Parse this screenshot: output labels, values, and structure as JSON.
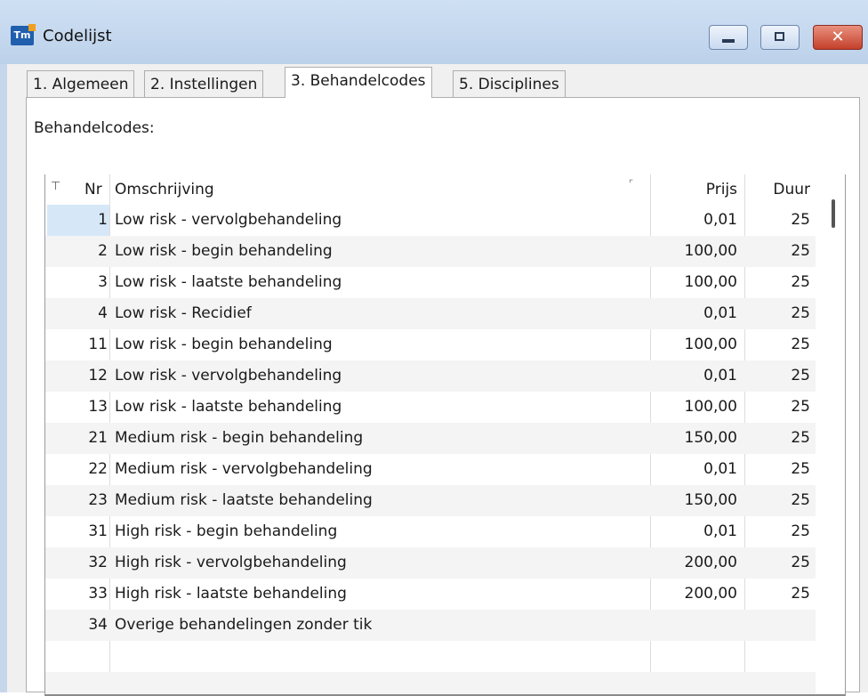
{
  "window": {
    "title": "Codelijst"
  },
  "tabs": [
    {
      "label": "1. Algemeen"
    },
    {
      "label": "2. Instellingen"
    },
    {
      "label": "3. Behandelcodes"
    },
    {
      "label": "5. Disciplines"
    }
  ],
  "active_tab": "3. Behandelcodes",
  "section": {
    "label": "Behandelcodes:"
  },
  "grid": {
    "columns": {
      "nr": "Nr",
      "omschrijving": "Omschrijving",
      "prijs": "Prijs",
      "duur": "Duur"
    },
    "rows": [
      {
        "nr": "1",
        "omschrijving": "Low risk - vervolgbehandeling",
        "prijs": "0,01",
        "duur": "25"
      },
      {
        "nr": "2",
        "omschrijving": "Low risk - begin behandeling",
        "prijs": "100,00",
        "duur": "25"
      },
      {
        "nr": "3",
        "omschrijving": "Low risk - laatste behandeling",
        "prijs": "100,00",
        "duur": "25"
      },
      {
        "nr": "4",
        "omschrijving": "Low risk - Recidief",
        "prijs": "0,01",
        "duur": "25"
      },
      {
        "nr": "11",
        "omschrijving": "Low risk - begin behandeling",
        "prijs": "100,00",
        "duur": "25"
      },
      {
        "nr": "12",
        "omschrijving": "Low risk - vervolgbehandeling",
        "prijs": "0,01",
        "duur": "25"
      },
      {
        "nr": "13",
        "omschrijving": "Low risk - laatste behandeling",
        "prijs": "100,00",
        "duur": "25"
      },
      {
        "nr": "21",
        "omschrijving": "Medium risk - begin behandeling",
        "prijs": "150,00",
        "duur": "25"
      },
      {
        "nr": "22",
        "omschrijving": "Medium risk - vervolgbehandeling",
        "prijs": "0,01",
        "duur": "25"
      },
      {
        "nr": "23",
        "omschrijving": "Medium risk - laatste behandeling",
        "prijs": "150,00",
        "duur": "25"
      },
      {
        "nr": "31",
        "omschrijving": "High risk - begin behandeling",
        "prijs": "0,01",
        "duur": "25"
      },
      {
        "nr": "32",
        "omschrijving": "High risk - vervolgbehandeling",
        "prijs": "200,00",
        "duur": "25"
      },
      {
        "nr": "33",
        "omschrijving": "High risk - laatste behandeling",
        "prijs": "200,00",
        "duur": "25"
      },
      {
        "nr": "34",
        "omschrijving": "Overige behandelingen zonder tik",
        "prijs": "",
        "duur": ""
      }
    ]
  },
  "icons": {
    "app": "app-logo-icon",
    "filter": "filter-icon",
    "sort": "sort-icon",
    "minimize": "minimize-icon",
    "maximize": "maximize-icon",
    "close": "close-icon"
  },
  "colors": {
    "selection": "#d6e8f8",
    "close_button": "#c4402b"
  }
}
